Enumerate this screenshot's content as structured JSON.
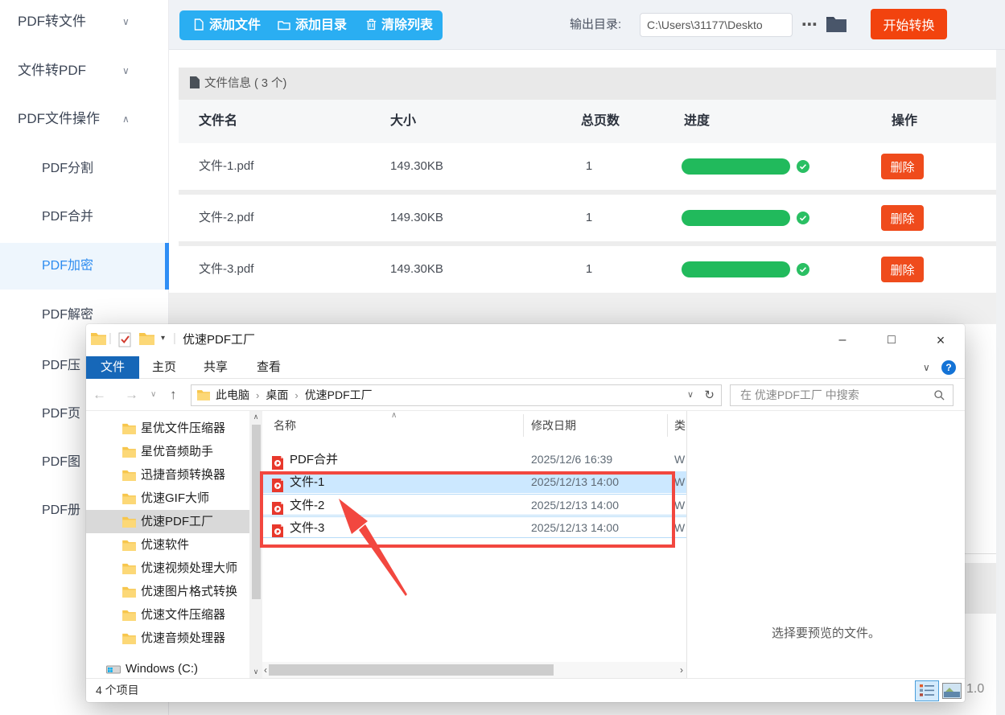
{
  "colors": {
    "toolbar_blue": "#2aaef2",
    "start_orange": "#f2430e",
    "delete_red": "#ef4b1c",
    "progress_green": "#21ba5c",
    "selected_blue": "#2d8cf0",
    "file_tab_blue": "#1667b8",
    "annotation_red": "#f2473f"
  },
  "sidebar": {
    "items": [
      {
        "label": "PDF转文件",
        "chevron": "∨"
      },
      {
        "label": "文件转PDF",
        "chevron": "∨"
      },
      {
        "label": "PDF文件操作",
        "chevron": "∧"
      },
      {
        "label": "PDF分割"
      },
      {
        "label": "PDF合并"
      },
      {
        "label": "PDF加密"
      },
      {
        "label": "PDF解密"
      },
      {
        "label": "PDF压"
      },
      {
        "label": "PDF页"
      },
      {
        "label": "PDF图"
      },
      {
        "label": "PDF册"
      }
    ]
  },
  "toolbar": {
    "add_file": "添加文件",
    "add_dir": "添加目录",
    "clear_list": "清除列表",
    "output_label": "输出目录:",
    "output_path": "C:\\Users\\31177\\Deskto",
    "more": "⋯",
    "start": "开始转换"
  },
  "fileinfo": {
    "label": "文件信息",
    "count": "( 3 个)"
  },
  "table": {
    "headers": {
      "name": "文件名",
      "size": "大小",
      "pages": "总页数",
      "progress": "进度",
      "action": "操作"
    },
    "rows": [
      {
        "name": "文件-1.pdf",
        "size": "149.30KB",
        "pages": "1",
        "progress": 100,
        "action": "删除"
      },
      {
        "name": "文件-2.pdf",
        "size": "149.30KB",
        "pages": "1",
        "progress": 100,
        "action": "删除"
      },
      {
        "name": "文件-3.pdf",
        "size": "149.30KB",
        "pages": "1",
        "progress": 100,
        "action": "删除"
      }
    ]
  },
  "version": "1.0",
  "explorer": {
    "title": "优速PDF工厂",
    "titlebar": {
      "caret": "▾",
      "sep": "|"
    },
    "controls": {
      "minimize": "–",
      "maximize": "□",
      "close": "×"
    },
    "menu": {
      "file": "文件",
      "home": "主页",
      "share": "共享",
      "view": "查看",
      "chevron": "∨",
      "help": "?"
    },
    "nav": {
      "back": "←",
      "forward": "→",
      "dropdown": "∨",
      "up": "↑",
      "refresh": "↻",
      "box_dropdown": "∨"
    },
    "breadcrumb": {
      "root": "此电脑",
      "sep": "›",
      "mid": "桌面",
      "leaf": "优速PDF工厂"
    },
    "search_text": "在 优速PDF工厂 中搜索",
    "tree": {
      "items": [
        "星优文件压缩器",
        "星优音频助手",
        "迅捷音频转换器",
        "优速GIF大师",
        "优速PDF工厂",
        "优速软件",
        "优速视频处理大师",
        "优速图片格式转换",
        "优速文件压缩器",
        "优速音频处理器"
      ],
      "drive": "Windows (C:)"
    },
    "list": {
      "columns": {
        "name": "名称",
        "date": "修改日期",
        "type": "类"
      },
      "sort_caret": "∧",
      "files": [
        {
          "name": "PDF合并",
          "date": "2025/12/6 16:39",
          "type": "W"
        },
        {
          "name": "文件-1",
          "date": "2025/12/13 14:00",
          "type": "W"
        },
        {
          "name": "文件-2",
          "date": "2025/12/13 14:00",
          "type": "W"
        },
        {
          "name": "文件-3",
          "date": "2025/12/13 14:00",
          "type": "W"
        }
      ]
    },
    "preview_text": "选择要预览的文件。",
    "status": "4 个项目",
    "scroll": {
      "left": "‹",
      "right": "›",
      "up": "∧",
      "down": "∨"
    }
  }
}
